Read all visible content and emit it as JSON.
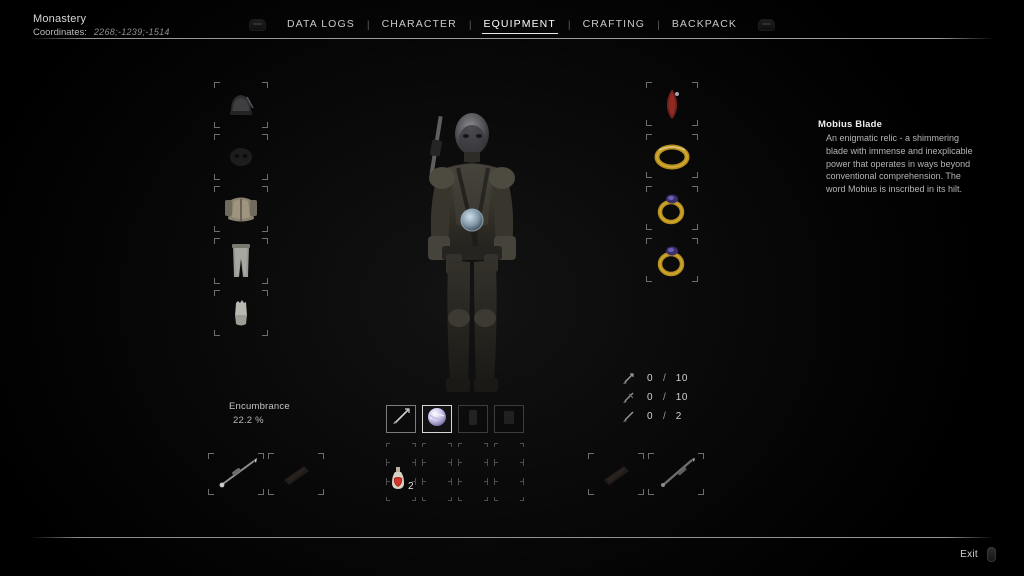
{
  "header": {
    "location_name": "Monastery",
    "coordinates_label": "Coordinates:",
    "coordinates_value": "2268;-1239;-1514",
    "left_bumper_icon": "left-bumper-icon",
    "right_bumper_icon": "right-bumper-icon",
    "separator": "|",
    "tabs": [
      {
        "label": "DATA LOGS",
        "active": false
      },
      {
        "label": "CHARACTER",
        "active": false
      },
      {
        "label": "EQUIPMENT",
        "active": true
      },
      {
        "label": "CRAFTING",
        "active": false
      },
      {
        "label": "BACKPACK",
        "active": false
      }
    ]
  },
  "armor_slots": [
    {
      "name": "head-slot",
      "item": "helmet"
    },
    {
      "name": "face-slot",
      "item": "mask"
    },
    {
      "name": "chest-slot",
      "item": "body-armor"
    },
    {
      "name": "legs-slot",
      "item": "trousers"
    },
    {
      "name": "hands-slot",
      "item": "gloves"
    }
  ],
  "accessory_slots": [
    {
      "name": "amulet-slot",
      "item": "red-relic"
    },
    {
      "name": "ring-slot-1",
      "item": "gold-band"
    },
    {
      "name": "ring-slot-2",
      "item": "gem-ring"
    },
    {
      "name": "ring-slot-3",
      "item": "gem-ring"
    }
  ],
  "weapon_slots_left": [
    {
      "name": "primary-weapon-slot",
      "item": "spear"
    },
    {
      "name": "secondary-weapon-slot",
      "item": "dark-blade"
    }
  ],
  "weapon_slots_right": [
    {
      "name": "tertiary-weapon-slot",
      "item": "dark-blade"
    },
    {
      "name": "quaternary-weapon-slot",
      "item": "longsword"
    }
  ],
  "quickslots": [
    {
      "name": "quickslot-1",
      "item": "sword",
      "selected": false,
      "dim": false
    },
    {
      "name": "quickslot-2",
      "item": "mobius-blade-orb",
      "selected": true,
      "dim": false
    },
    {
      "name": "quickslot-3",
      "item": "unknown",
      "selected": false,
      "dim": true
    },
    {
      "name": "quickslot-4",
      "item": "unknown",
      "selected": false,
      "dim": true
    }
  ],
  "consumables": {
    "columns": 4,
    "rows": 3,
    "items": [
      {
        "name": "consumable-health-potion",
        "row": 2,
        "col": 0,
        "quantity": "2"
      }
    ]
  },
  "encumbrance": {
    "label": "Encumbrance",
    "value": "22.2 %"
  },
  "ammo": [
    {
      "name": "ammo-arrow",
      "icon": "arrow-icon",
      "current": "0",
      "separator": "/",
      "max": "10"
    },
    {
      "name": "ammo-bolt",
      "icon": "bolt-icon",
      "current": "0",
      "separator": "/",
      "max": "10"
    },
    {
      "name": "ammo-special",
      "icon": "dart-icon",
      "current": "0",
      "separator": "/",
      "max": "2"
    }
  ],
  "info_panel": {
    "title": "Mobius Blade",
    "description": "An enigmatic relic - a shimmering blade with immense and inexplicable power that operates in ways beyond conventional comprehension. The word Mobius is inscribed in its hilt."
  },
  "footer": {
    "exit_label": "Exit",
    "exit_key_icon": "controller-button-icon"
  },
  "colors": {
    "background": "#000000",
    "panel_glow": "#131313",
    "text_primary": "#e8e8e8",
    "text_secondary": "#b4b4b4",
    "slot_border": "#6e6e6e",
    "accent_gold": "#c9a227"
  }
}
